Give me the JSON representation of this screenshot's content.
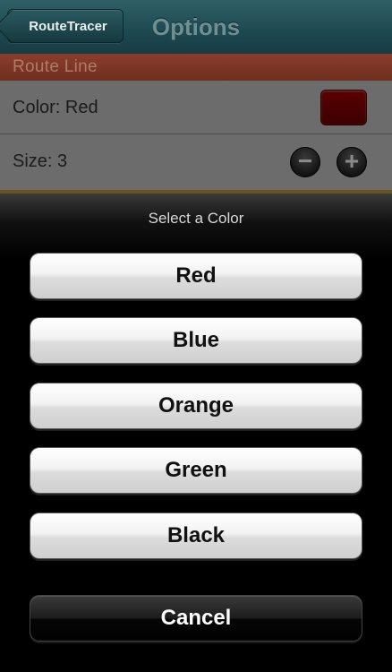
{
  "navbar": {
    "back_label": "RouteTracer",
    "title": "Options"
  },
  "section": {
    "header": "Route Line",
    "color_row_label": "Color: Red",
    "size_row_label": "Size: 3",
    "swatch_color": "#4a0000"
  },
  "stepper": {
    "minus_glyph": "−",
    "plus_glyph": "+"
  },
  "action_sheet": {
    "title": "Select a Color",
    "options": [
      "Red",
      "Blue",
      "Orange",
      "Green",
      "Black"
    ],
    "cancel_label": "Cancel"
  }
}
